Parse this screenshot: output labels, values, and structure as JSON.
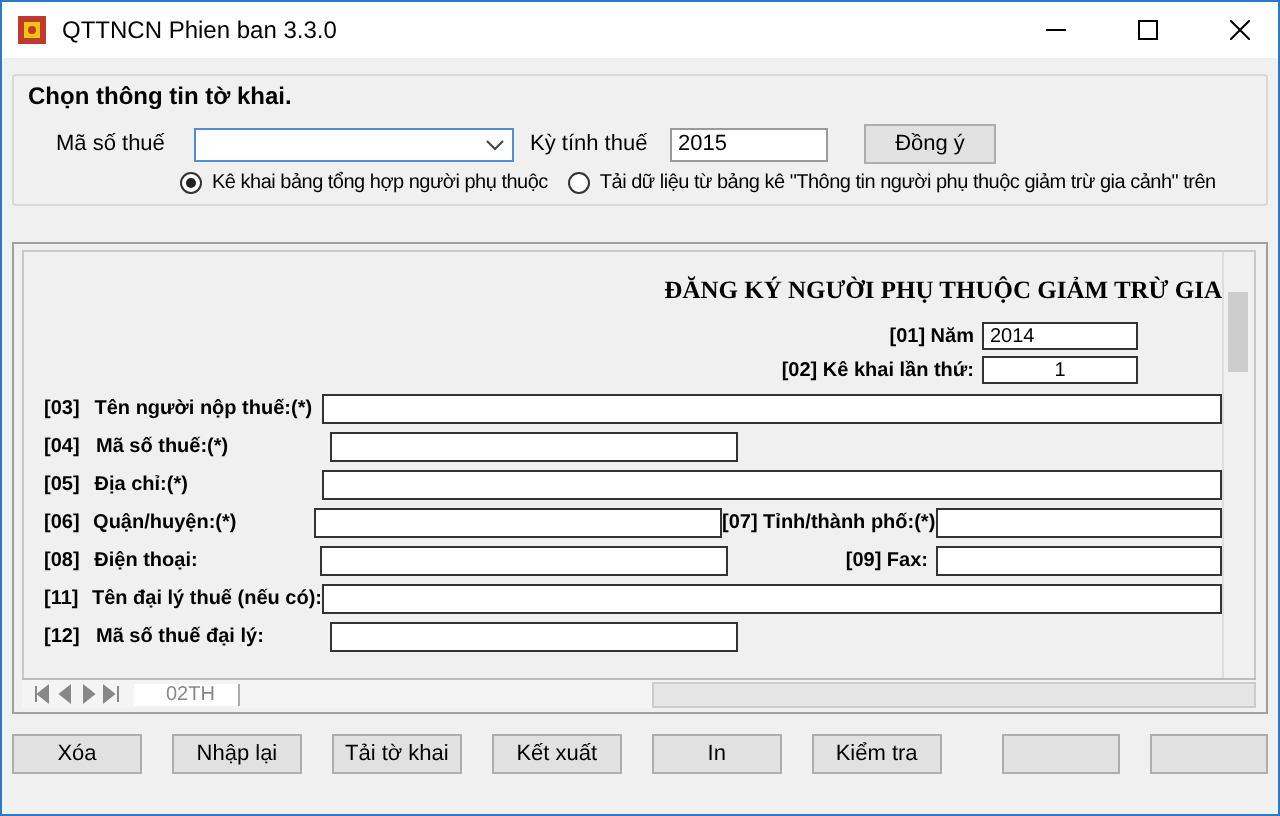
{
  "window": {
    "title": "QTTNCN Phien ban 3.3.0"
  },
  "selection": {
    "title": "Chọn thông tin tờ khai.",
    "tax_code_label": "Mã số thuế",
    "period_label": "Kỳ tính thuế",
    "period_value": "2015",
    "confirm_button": "Đồng ý",
    "options": [
      {
        "label": "Kê khai bảng tổng hợp người phụ thuộc",
        "selected": true
      },
      {
        "label": "Tải dữ liệu từ bảng kê \"Thông tin người phụ thuộc giảm trừ gia cảnh\" trên",
        "selected": false
      }
    ]
  },
  "form": {
    "heading": "ĐĂNG KÝ NGƯỜI PHỤ THUỘC GIẢM TRỪ GIA",
    "year_label": "[01] Năm",
    "year_value": "2014",
    "times_label": "[02] Kê khai lần thứ:",
    "times_value": "1",
    "rows": [
      {
        "code": "[03]",
        "label": "Tên người nộp thuế:(*)",
        "kind": "long"
      },
      {
        "code": "[04]",
        "label": "Mã số thuế:(*)",
        "kind": "short"
      },
      {
        "code": "[05]",
        "label": "Địa chỉ:(*)",
        "kind": "long"
      },
      {
        "code": "[06]",
        "label": "Quận/huyện:(*)",
        "kind": "pair",
        "right_label": "[07] Tỉnh/thành phố:(*)"
      },
      {
        "code": "[08]",
        "label": "Điện thoại:",
        "kind": "pair",
        "right_label": "[09] Fax:"
      },
      {
        "code": "[11]",
        "label": "Tên đại lý thuế (nếu có):",
        "kind": "long"
      },
      {
        "code": "[12]",
        "label": "Mã số thuế đại lý:",
        "kind": "short"
      }
    ],
    "sheet_tab": "02TH"
  },
  "buttons": [
    "Xóa",
    "Nhập lại",
    "Tải tờ khai",
    "Kết xuất",
    "In",
    "Kiểm tra"
  ]
}
